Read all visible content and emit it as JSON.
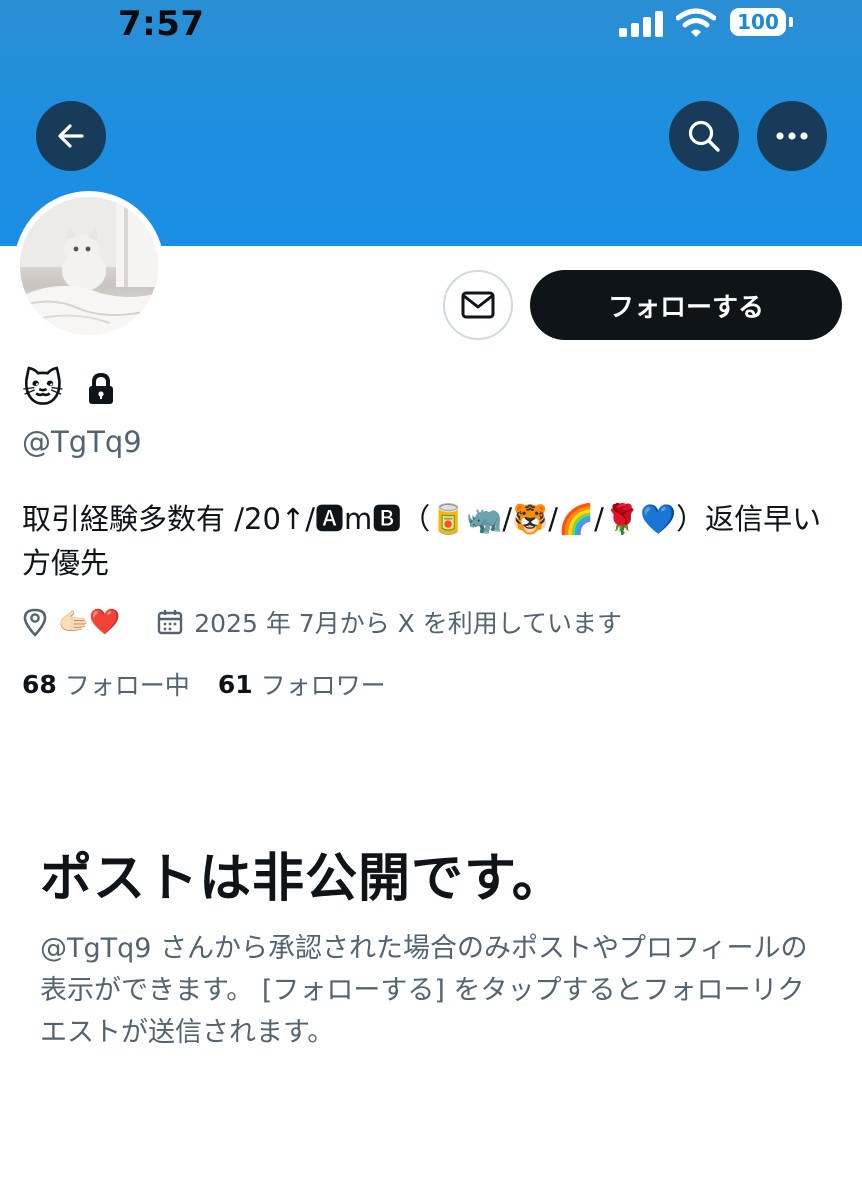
{
  "status_bar": {
    "time": "7:57",
    "battery": "100",
    "icons": [
      "signal-icon",
      "wifi-icon",
      "battery-icon"
    ]
  },
  "header": {
    "back_icon": "arrow-left-icon",
    "search_icon": "search-icon",
    "more_icon": "more-horizontal-icon"
  },
  "profile": {
    "avatar_icon": "avatar-photo",
    "follow_label": "フォローする",
    "message_icon": "mail-icon",
    "display_name": "🐱",
    "protected_icon": "lock-icon",
    "handle": "@TgTq9",
    "bio": "取引経験多数有 /20↑/🅰m🅱（🥫🦏/🐯/🌈/🌹💙）返信早い方優先",
    "location": "🫱🏻❤️",
    "joined": "2025 年 7月から X を利用しています",
    "following_count": "68",
    "following_label": "フォロー中",
    "followers_count": "61",
    "followers_label": "フォロワー"
  },
  "private_notice": {
    "title": "ポストは非公開です。",
    "description": "@TgTq9 さんから承認された場合のみポストやプロフィールの表示ができます。 [フォローする] をタップするとフォローリクエストが送信されます。"
  },
  "colors": {
    "banner": "#1d8fe0",
    "header_button": "#173b59",
    "primary_text": "#0f1419",
    "secondary_text": "#536471",
    "follow_button": "#0f1419"
  }
}
